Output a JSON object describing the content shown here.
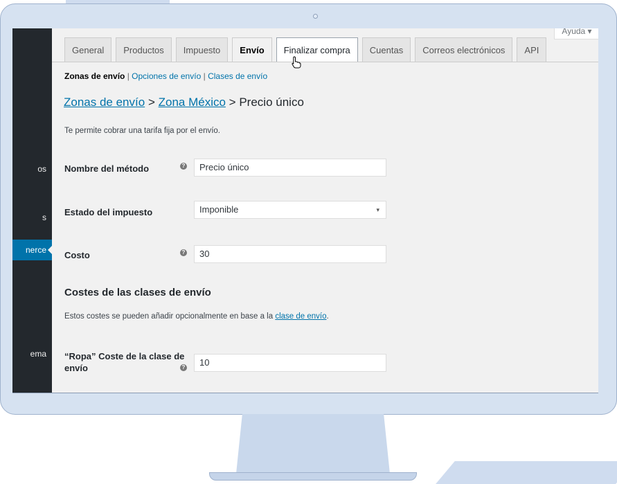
{
  "help": {
    "label": "Ayuda ▾"
  },
  "sidebar": {
    "items": [
      {
        "label": "os"
      },
      {
        "label": "s"
      },
      {
        "label": "nerce"
      },
      {
        "label": "ema"
      }
    ]
  },
  "tabs": [
    {
      "label": "General"
    },
    {
      "label": "Productos"
    },
    {
      "label": "Impuesto"
    },
    {
      "label": "Envío"
    },
    {
      "label": "Finalizar compra"
    },
    {
      "label": "Cuentas"
    },
    {
      "label": "Correos electrónicos"
    },
    {
      "label": "API"
    }
  ],
  "subnav": {
    "current": "Zonas de envío",
    "sep": "|",
    "links": [
      {
        "label": "Opciones de envío"
      },
      {
        "label": "Clases de envío"
      }
    ]
  },
  "breadcrumb": {
    "link1": "Zonas de envío",
    "sep": ">",
    "link2": "Zona México",
    "current": "Precio único"
  },
  "description": "Te permite cobrar una tarifa fija por el envío.",
  "form": {
    "method_name": {
      "label": "Nombre del método",
      "value": "Precio único"
    },
    "tax_status": {
      "label": "Estado del impuesto",
      "value": "Imponible"
    },
    "cost": {
      "label": "Costo",
      "value": "30"
    }
  },
  "shipping_classes": {
    "title": "Costes de las clases de envío",
    "desc": "Estos costes se pueden añadir opcionalmente en base a la",
    "link": "clase de envío",
    "period": ".",
    "ropa": {
      "label_line1": "“Ropa” Coste de la clase de",
      "label_line2": "envío",
      "value": "10"
    }
  },
  "icons": {
    "help_tip": "?",
    "select_arrow": "▾"
  },
  "colors": {
    "accent": "#0073aa",
    "sidebar": "#23282d",
    "content_bg": "#f1f1f1"
  }
}
